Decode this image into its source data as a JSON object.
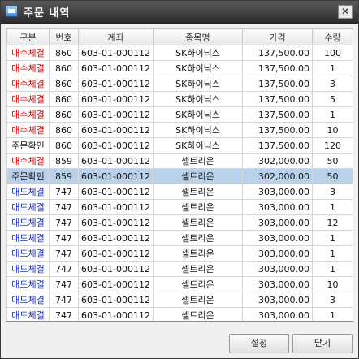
{
  "window": {
    "title": "주문 내역",
    "close_label": "✕"
  },
  "table": {
    "headers": [
      "구분",
      "번호",
      "계좌",
      "종목명",
      "가격",
      "수량"
    ],
    "rows": [
      {
        "type": "매수체결",
        "no": "860",
        "account": "603-01-000112",
        "name": "SK하이닉스",
        "price": "137,500.00",
        "qty": "100",
        "color": "#d40000"
      },
      {
        "type": "매수체결",
        "no": "860",
        "account": "603-01-000112",
        "name": "SK하이닉스",
        "price": "137,500.00",
        "qty": "1",
        "color": "#d40000"
      },
      {
        "type": "매수체결",
        "no": "860",
        "account": "603-01-000112",
        "name": "SK하이닉스",
        "price": "137,500.00",
        "qty": "3",
        "color": "#d40000"
      },
      {
        "type": "매수체결",
        "no": "860",
        "account": "603-01-000112",
        "name": "SK하이닉스",
        "price": "137,500.00",
        "qty": "5",
        "color": "#d40000"
      },
      {
        "type": "매수체결",
        "no": "860",
        "account": "603-01-000112",
        "name": "SK하이닉스",
        "price": "137,500.00",
        "qty": "1",
        "color": "#d40000"
      },
      {
        "type": "매수체결",
        "no": "860",
        "account": "603-01-000112",
        "name": "SK하이닉스",
        "price": "137,500.00",
        "qty": "10",
        "color": "#d40000"
      },
      {
        "type": "주문확인",
        "no": "860",
        "account": "603-01-000112",
        "name": "SK하이닉스",
        "price": "137,500.00",
        "qty": "120",
        "color": "#111111"
      },
      {
        "type": "매수체결",
        "no": "859",
        "account": "603-01-000112",
        "name": "셀트리온",
        "price": "302,000.00",
        "qty": "50",
        "color": "#d40000"
      },
      {
        "type": "주문확인",
        "no": "859",
        "account": "603-01-000112",
        "name": "셀트리온",
        "price": "302,000.00",
        "qty": "50",
        "color": "#111111",
        "selected": true
      },
      {
        "type": "매도체결",
        "no": "747",
        "account": "603-01-000112",
        "name": "셀트리온",
        "price": "303,000.00",
        "qty": "3",
        "color": "#1a2fbf"
      },
      {
        "type": "매도체결",
        "no": "747",
        "account": "603-01-000112",
        "name": "셀트리온",
        "price": "303,000.00",
        "qty": "1",
        "color": "#1a2fbf"
      },
      {
        "type": "매도체결",
        "no": "747",
        "account": "603-01-000112",
        "name": "셀트리온",
        "price": "303,000.00",
        "qty": "12",
        "color": "#1a2fbf"
      },
      {
        "type": "매도체결",
        "no": "747",
        "account": "603-01-000112",
        "name": "셀트리온",
        "price": "303,000.00",
        "qty": "1",
        "color": "#1a2fbf"
      },
      {
        "type": "매도체결",
        "no": "747",
        "account": "603-01-000112",
        "name": "셀트리온",
        "price": "303,000.00",
        "qty": "1",
        "color": "#1a2fbf"
      },
      {
        "type": "매도체결",
        "no": "747",
        "account": "603-01-000112",
        "name": "셀트리온",
        "price": "303,000.00",
        "qty": "1",
        "color": "#1a2fbf"
      },
      {
        "type": "매도체결",
        "no": "747",
        "account": "603-01-000112",
        "name": "셀트리온",
        "price": "303,000.00",
        "qty": "10",
        "color": "#1a2fbf"
      },
      {
        "type": "매도체결",
        "no": "747",
        "account": "603-01-000112",
        "name": "셀트리온",
        "price": "303,000.00",
        "qty": "3",
        "color": "#1a2fbf"
      },
      {
        "type": "매도체결",
        "no": "747",
        "account": "603-01-000112",
        "name": "셀트리온",
        "price": "303,000.00",
        "qty": "1",
        "color": "#1a2fbf"
      },
      {
        "type": "매도체결",
        "no": "747",
        "account": "603-01-000112",
        "name": "셀트리온",
        "price": "303,000.00",
        "qty": "2",
        "color": "#1a2fbf"
      }
    ]
  },
  "buttons": {
    "settings_label": "설정",
    "close_label": "닫기"
  }
}
